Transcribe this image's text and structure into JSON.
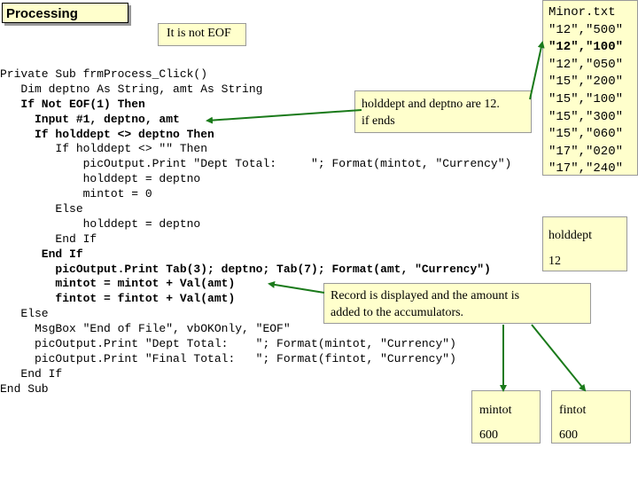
{
  "title": "Processing",
  "callouts": {
    "not_eof": "It is not EOF",
    "holddept_line1": "holddept and deptno are 12.",
    "holddept_line2": "if ends",
    "record_line1": "Record is displayed and the amount is",
    "record_line2": "added to the accumulators."
  },
  "code_lines": [
    "Private Sub frmProcess_Click()",
    "   Dim deptno As String, amt As String",
    "   If Not EOF(1) Then",
    "     Input #1, deptno, amt",
    "     If holddept <> deptno Then",
    "        If holddept <> \"\" Then",
    "            picOutput.Print \"Dept Total:     \"; Format(mintot, \"Currency\")",
    "            holddept = deptno",
    "            mintot = 0",
    "        Else",
    "            holddept = deptno",
    "        End If",
    "      End If",
    "        picOutput.Print Tab(3); deptno; Tab(7); Format(amt, \"Currency\")",
    "        mintot = mintot + Val(amt)",
    "        fintot = fintot + Val(amt)",
    "   Else",
    "     MsgBox \"End of File\", vbOKOnly, \"EOF\"",
    "     picOutput.Print \"Dept Total:    \"; Format(mintot, \"Currency\")",
    "     picOutput.Print \"Final Total:   \"; Format(fintot, \"Currency\")",
    "   End If",
    "End Sub"
  ],
  "file": {
    "name": "Minor.txt",
    "lines": [
      "\"12\",\"500\"",
      "\"12\",\"100\"",
      "\"12\",\"050\"",
      "\"15\",\"200\"",
      "\"15\",\"100\"",
      "\"15\",\"300\"",
      "\"15\",\"060\"",
      "\"17\",\"020\"",
      "\"17\",\"240\""
    ]
  },
  "variables": {
    "holddept": {
      "label": "holddept",
      "value": "12"
    },
    "mintot": {
      "label": "mintot",
      "value": "600"
    },
    "fintot": {
      "label": "fintot",
      "value": "600"
    }
  },
  "colors": {
    "highlight_bg": "#ffffcc",
    "arrow": "#1a7a1a",
    "shadow": "#999999"
  }
}
